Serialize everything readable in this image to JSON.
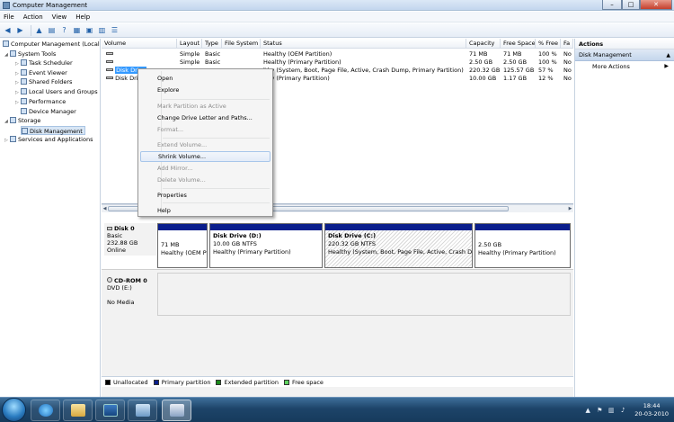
{
  "window": {
    "title": "Computer Management",
    "buttons": {
      "minimize": "–",
      "maximize": "□",
      "close": "✕"
    }
  },
  "menu": [
    "File",
    "Action",
    "View",
    "Help"
  ],
  "tree": {
    "root": "Computer Management (Local",
    "system_tools": "System Tools",
    "task_scheduler": "Task Scheduler",
    "event_viewer": "Event Viewer",
    "shared_folders": "Shared Folders",
    "local_users": "Local Users and Groups",
    "performance": "Performance",
    "device_manager": "Device Manager",
    "storage": "Storage",
    "disk_management": "Disk Management",
    "services": "Services and Applications"
  },
  "volumes": {
    "columns": [
      "Volume",
      "Layout",
      "Type",
      "File System",
      "Status",
      "Capacity",
      "Free Space",
      "% Free",
      "Fa"
    ],
    "rows": [
      {
        "volume": "",
        "layout": "Simple",
        "type": "Basic",
        "fs": "",
        "status": "Healthy (OEM Partition)",
        "capacity": "71 MB",
        "free": "71 MB",
        "pct": "100 %",
        "fault": "No"
      },
      {
        "volume": "",
        "layout": "Simple",
        "type": "Basic",
        "fs": "",
        "status": "Healthy (Primary Partition)",
        "capacity": "2.50 GB",
        "free": "2.50 GB",
        "pct": "100 %",
        "fault": "No"
      },
      {
        "volume": "Disk Drive",
        "layout": "",
        "type": "",
        "fs": "",
        "status": "lthy (System, Boot, Page File, Active, Crash Dump, Primary Partition)",
        "capacity": "220.32 GB",
        "free": "125.57 GB",
        "pct": "57 %",
        "fault": "No"
      },
      {
        "volume": "Disk Dri",
        "layout": "",
        "type": "",
        "fs": "",
        "status": "lthy (Primary Partition)",
        "capacity": "10.00 GB",
        "free": "1.17 GB",
        "pct": "12 %",
        "fault": "No"
      }
    ]
  },
  "context_menu": {
    "open": "Open",
    "explore": "Explore",
    "mark_active": "Mark Partition as Active",
    "change_letter": "Change Drive Letter and Paths...",
    "format": "Format...",
    "extend": "Extend Volume...",
    "shrink": "Shrink Volume...",
    "add_mirror": "Add Mirror...",
    "delete": "Delete Volume...",
    "properties": "Properties",
    "help": "Help"
  },
  "disk0": {
    "name": "Disk 0",
    "type": "Basic",
    "size": "232.88 GB",
    "state": "Online",
    "partitions": [
      {
        "title": "",
        "size": "71 MB",
        "status": "Healthy (OEM P"
      },
      {
        "title": "Disk Drive  (D:)",
        "size": "10.00 GB NTFS",
        "status": "Healthy (Primary Partition)"
      },
      {
        "title": "Disk Drive  (C:)",
        "size": "220.32 GB NTFS",
        "status": "Healthy (System, Boot, Page File, Active, Crash Dum"
      },
      {
        "title": "",
        "size": "2.50 GB",
        "status": "Healthy (Primary Partition)"
      }
    ]
  },
  "cdrom": {
    "name": "CD-ROM 0",
    "type": "DVD (E:)",
    "media": "No Media"
  },
  "legend": [
    {
      "label": "Unallocated",
      "color": "#000000"
    },
    {
      "label": "Primary partition",
      "color": "#0a1e8c"
    },
    {
      "label": "Extended partition",
      "color": "#1c8a1c"
    },
    {
      "label": "Free space",
      "color": "#5fd35f"
    }
  ],
  "actions": {
    "header": "Actions",
    "section": "Disk Management",
    "more": "More Actions"
  },
  "taskbar": {
    "time": "18:44",
    "date": "20-03-2010"
  },
  "colors": {
    "primary_partition": "#0a1e8c",
    "highlight": "#d8e6f5"
  }
}
